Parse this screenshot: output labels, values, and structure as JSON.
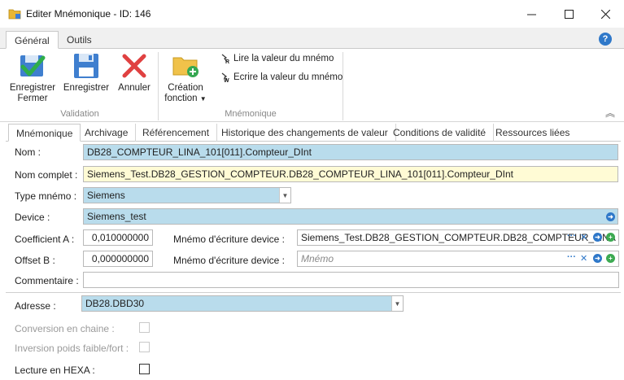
{
  "window": {
    "title": "Editer Mnémonique - ID: 146",
    "minimize": "—",
    "maximize": "☐",
    "close": "✕"
  },
  "ribbon": {
    "tabs": [
      "Général",
      "Outils"
    ],
    "help": "?",
    "validation": {
      "save_close": [
        "Enregistrer",
        "Fermer"
      ],
      "save": "Enregistrer",
      "cancel": "Annuler",
      "group_label": "Validation"
    },
    "mnemonique": {
      "create_function": [
        "Création",
        "fonction"
      ],
      "read_value": "Lire la valeur du mnémo",
      "write_value": "Ecrire la valeur du mnémo",
      "group_label": "Mnémonique"
    },
    "collapse": "︽"
  },
  "detail_tabs": [
    "Mnémonique",
    "Archivage",
    "Référencement",
    "Historique des changements de valeur",
    "Conditions de validité",
    "Ressources liées"
  ],
  "form": {
    "nom": {
      "label": "Nom :",
      "value": "DB28_COMPTEUR_LINA_101[011].Compteur_DInt"
    },
    "nom_complet": {
      "label": "Nom complet :",
      "value": "Siemens_Test.DB28_GESTION_COMPTEUR.DB28_COMPTEUR_LINA_101[011].Compteur_DInt"
    },
    "type_mnemo": {
      "label": "Type mnémo :",
      "value": "Siemens"
    },
    "device": {
      "label": "Device :",
      "value": "Siemens_test"
    },
    "coef_a": {
      "label": "Coefficient A :",
      "value": "0,010000000"
    },
    "offset_b": {
      "label": "Offset B :",
      "value": "0,000000000"
    },
    "mnemo_write_1": {
      "label": "Mnémo d'écriture device :",
      "value": "Siemens_Test.DB28_GESTION_COMPTEUR.DB28_COMPTEUR_LINA"
    },
    "mnemo_write_2": {
      "label": "Mnémo d'écriture device :",
      "placeholder": "Mnémo"
    },
    "commentaire": {
      "label": "Commentaire :",
      "value": ""
    },
    "adresse": {
      "label": "Adresse :",
      "value": "DB28.DBD30"
    },
    "conversion": {
      "label": "Conversion en chaine :"
    },
    "inversion": {
      "label": "Inversion poids faible/fort :"
    },
    "lecture_hexa": {
      "label": "Lecture en HEXA :"
    }
  },
  "icons": {
    "ellipsis": "···",
    "clear": "✕",
    "goto": "➜",
    "add": "+"
  },
  "colors": {
    "field_blue": "#b9dcec",
    "field_yellow": "#fffbd5",
    "accent_blue": "#2f78c9",
    "green": "#3daa52"
  }
}
